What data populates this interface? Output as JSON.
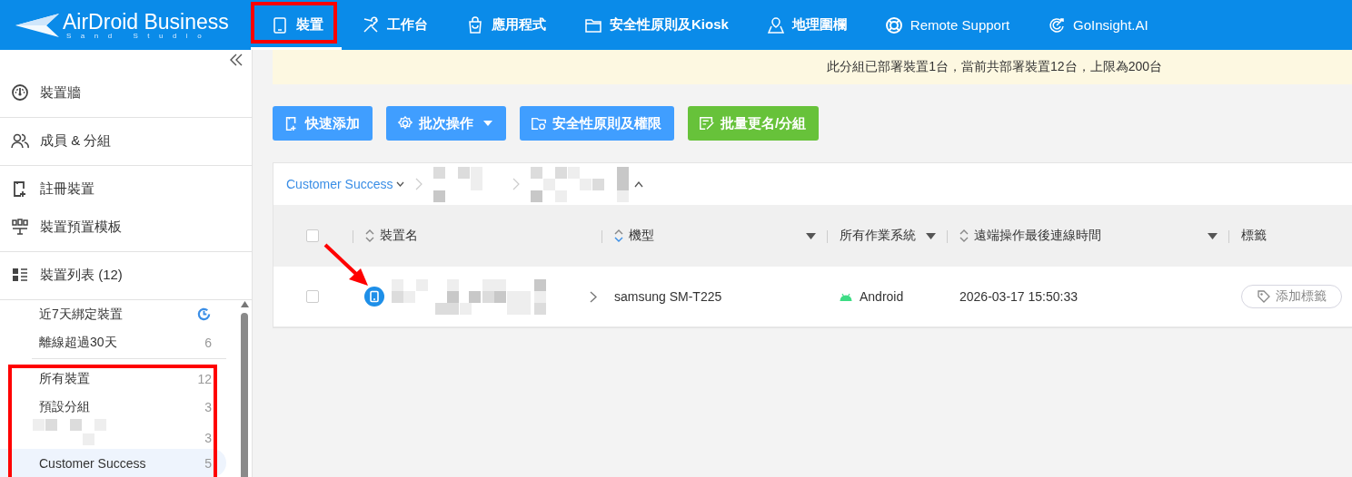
{
  "logo": {
    "name": "AirDroid Business",
    "tagline": "Sand Studio"
  },
  "nav_tabs": [
    {
      "label": "裝置",
      "selected": true
    },
    {
      "label": "工作台",
      "selected": false
    },
    {
      "label": "應用程式",
      "selected": false
    },
    {
      "label": "安全性原則及Kiosk",
      "selected": false
    },
    {
      "label": "地理圍欄",
      "selected": false
    },
    {
      "label": "Remote Support",
      "selected": false
    },
    {
      "label": "GoInsight.AI",
      "selected": false
    }
  ],
  "sidebar": {
    "sections": [
      [
        {
          "label": "裝置牆"
        }
      ],
      [
        {
          "label": "成員 & 分組"
        }
      ],
      [
        {
          "label": "註冊裝置"
        },
        {
          "label": "裝置預置模板"
        }
      ],
      [
        {
          "label": "裝置列表 (12)"
        }
      ]
    ],
    "filters": [
      {
        "kind": "recent",
        "label": "近7天綁定裝置"
      },
      {
        "kind": "count",
        "label": "離線超過30天",
        "count": "6"
      }
    ],
    "groups": [
      {
        "kind": "named",
        "label": "所有裝置",
        "count": "12",
        "selected": false
      },
      {
        "kind": "named",
        "label": "預設分組",
        "count": "3",
        "selected": false
      },
      {
        "kind": "redacted",
        "count": "3",
        "selected": false
      },
      {
        "kind": "named",
        "label": "Customer Success",
        "count": "5",
        "selected": true
      }
    ]
  },
  "notice": "此分組已部署裝置1台，當前共部署裝置12台，上限為200台",
  "toolbar": [
    {
      "label": "快速添加",
      "kind": "primary",
      "dropdown": false
    },
    {
      "label": "批次操作",
      "kind": "primary",
      "dropdown": true
    },
    {
      "label": "安全性原則及權限",
      "kind": "primary",
      "dropdown": false
    },
    {
      "label": "批量更名/分組",
      "kind": "success",
      "dropdown": false
    }
  ],
  "breadcrumb": [
    {
      "kind": "link",
      "label": "Customer Success"
    },
    {
      "kind": "redacted"
    },
    {
      "kind": "redacted"
    }
  ],
  "table": {
    "select_all": {
      "checked": false
    },
    "columns": [
      {
        "label": "裝置名",
        "sorted": false,
        "filter": false
      },
      {
        "label": "機型",
        "sorted": true,
        "filter": true
      },
      {
        "label": "所有作業系統",
        "filter": true
      },
      {
        "label": "遠端操作最後連線時間",
        "sorted": false,
        "filter": true
      },
      {
        "label": "標籤",
        "filter": false
      }
    ],
    "rows": [
      {
        "checked": false,
        "model": "samsung SM-T225",
        "os": "Android",
        "last_seen": "2026-03-17 15:50:33",
        "tag_button": "添加標籤"
      }
    ]
  },
  "annotations": [
    {
      "kind": "frame"
    },
    {
      "kind": "frame"
    },
    {
      "kind": "arrow"
    }
  ]
}
